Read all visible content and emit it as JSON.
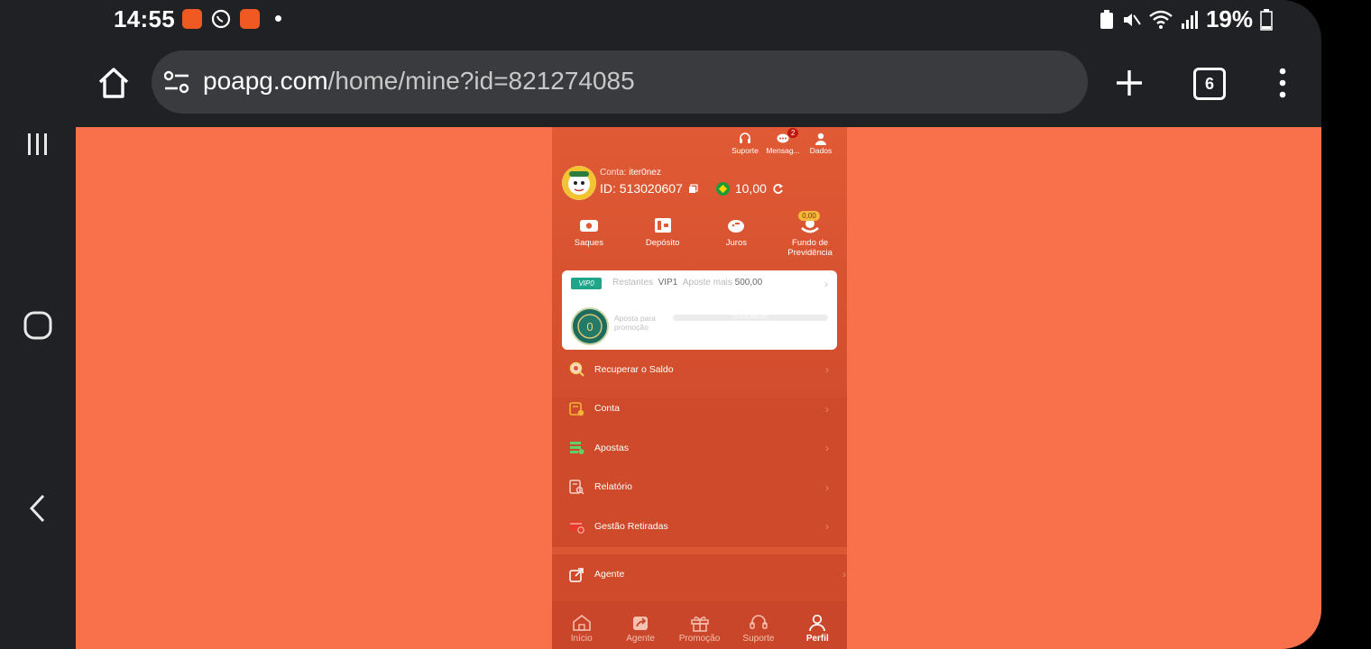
{
  "status_bar": {
    "time": "14:55",
    "battery": "19%"
  },
  "browser": {
    "url_domain": "poapg.com",
    "url_path": "/home/mine?id=821274085",
    "tab_count": "6"
  },
  "app": {
    "top_icons": [
      {
        "label": "Suporte",
        "icon": "headset-icon"
      },
      {
        "label": "Mensag...",
        "icon": "message-icon",
        "badge": "2"
      },
      {
        "label": "Dados",
        "icon": "user-data-icon"
      }
    ],
    "account_label": "Conta:",
    "account_name": "iter0nez",
    "id_text": "ID: 513020607",
    "balance": "10,00",
    "actions": [
      {
        "label": "Saques",
        "icon": "withdraw-icon"
      },
      {
        "label": "Depósito",
        "icon": "deposit-icon"
      },
      {
        "label": "Juros",
        "icon": "piggy-bank-icon"
      },
      {
        "label": "Fundo de Previdência",
        "icon": "fund-icon",
        "pill": "0,00"
      }
    ],
    "vip": {
      "tag": "VIP0",
      "remaining_label": "Restantes",
      "level": "VIP1",
      "bet_more_label": "Aposte mais",
      "bet_more_value": "500,00",
      "sub_label": "Aposta para promoção",
      "progress_text": "0,00/0,500,00",
      "progress_fraction": 0
    },
    "menu": [
      {
        "label": "Recuperar o Saldo",
        "icon": "search-money-icon",
        "color": "#f7d36b"
      },
      {
        "label": "Conta",
        "icon": "account-icon",
        "color": "#f2b43a"
      },
      {
        "label": "Apostas",
        "icon": "bets-icon",
        "color": "#5fd16a"
      },
      {
        "label": "Relatório",
        "icon": "report-icon",
        "color": "#f4d1c8"
      },
      {
        "label": "Gestão Retiradas",
        "icon": "withdraw-manage-icon",
        "color": "#e63b2a"
      }
    ],
    "agent_item": {
      "label": "Agente",
      "icon": "share-icon"
    },
    "bottom_nav": [
      {
        "label": "Início",
        "icon": "home-icon"
      },
      {
        "label": "Agente",
        "icon": "share-icon"
      },
      {
        "label": "Promoção",
        "icon": "gift-icon"
      },
      {
        "label": "Suporte",
        "icon": "headset-icon"
      },
      {
        "label": "Perfil",
        "icon": "profile-icon",
        "active": true
      }
    ]
  }
}
